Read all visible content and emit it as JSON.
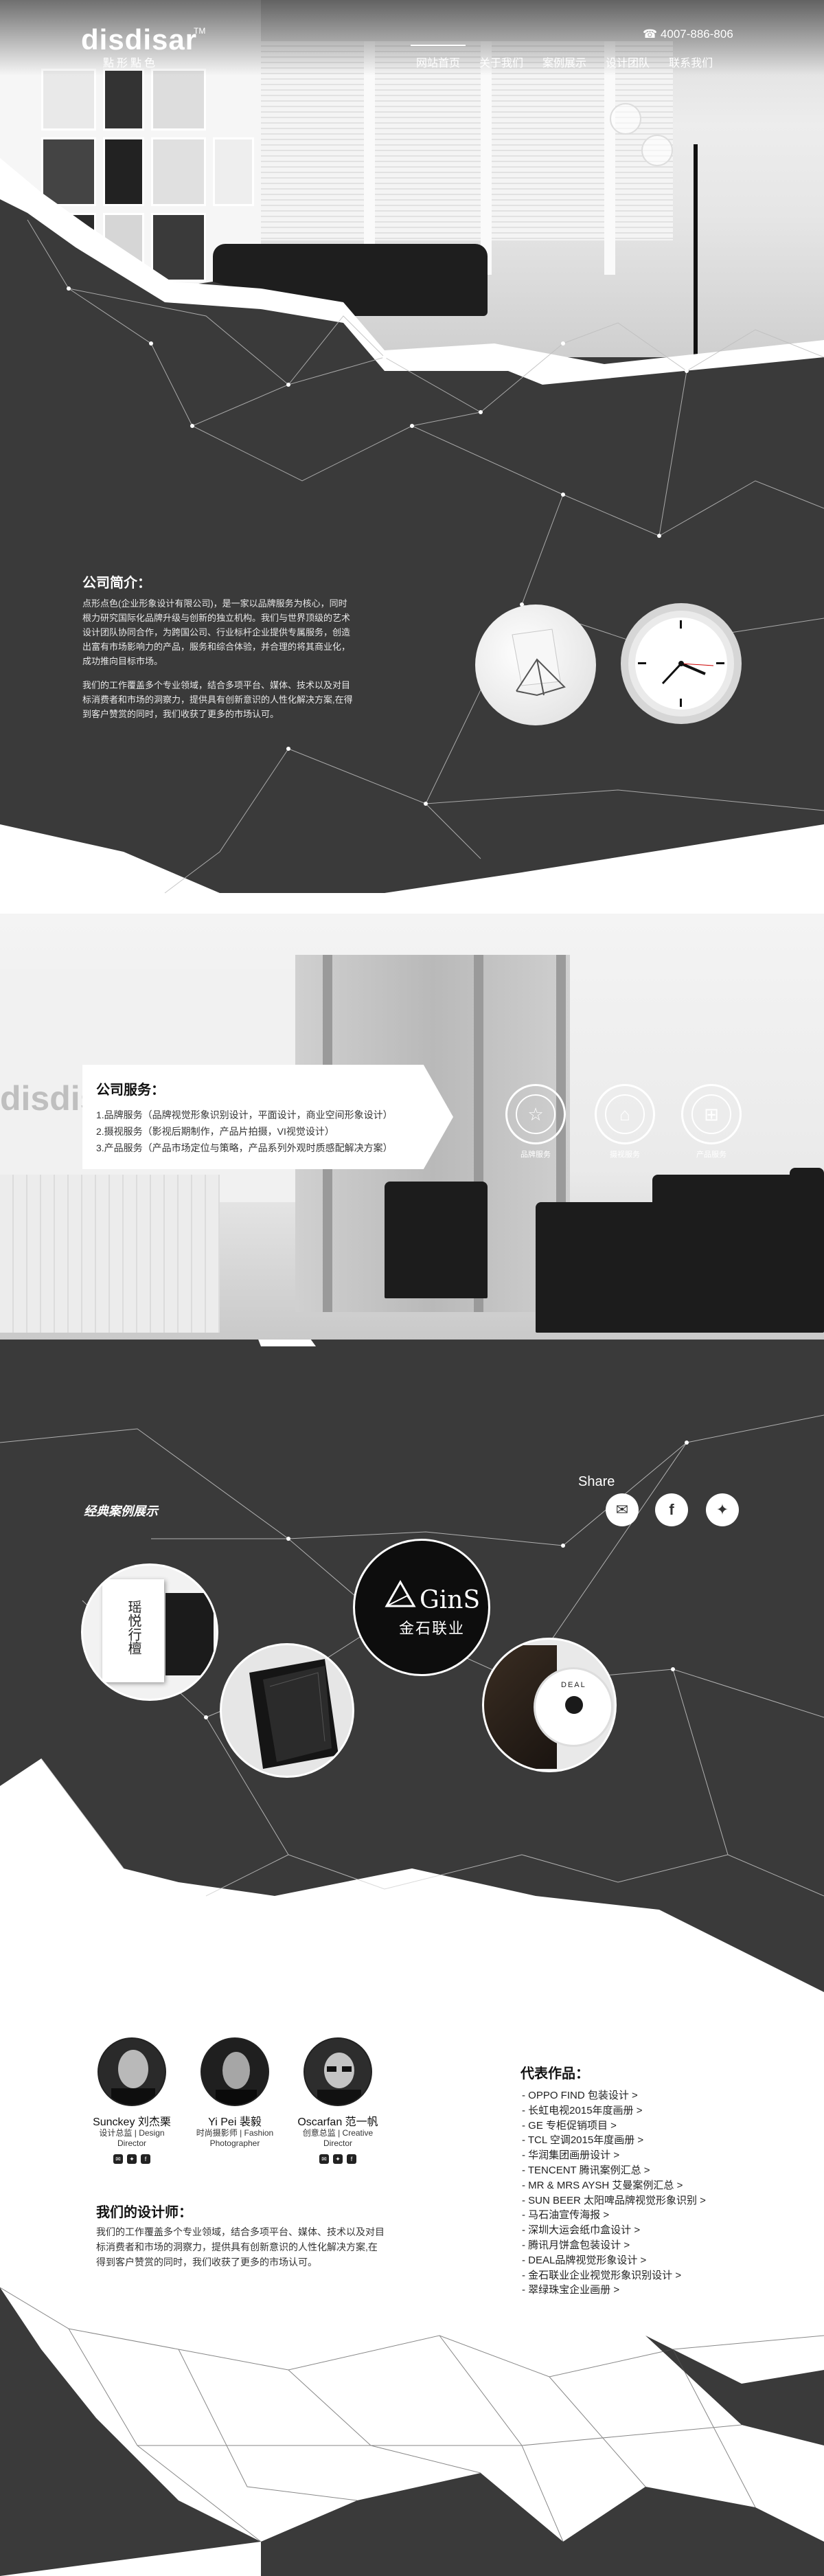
{
  "brand": {
    "logo": "disdisar",
    "tm": "TM",
    "logo_cn": "點形點色"
  },
  "header": {
    "phone": "4007-886-806",
    "nav": [
      {
        "label": "网站首页",
        "active": true
      },
      {
        "label": "关于我们",
        "active": false
      },
      {
        "label": "案例展示",
        "active": false
      },
      {
        "label": "设计团队",
        "active": false
      },
      {
        "label": "联系我们",
        "active": false
      }
    ]
  },
  "about": {
    "title": "公司简介：",
    "para1": [
      "点形点色(企业形象设计有限公司)，是一家以品牌服务为核心，同时",
      "根力研究国际化品牌升级与创新的独立机构。我们与世界顶级的艺术",
      "设计团队协同合作，为跨国公司、行业标杆企业提供专属服务，创造",
      "出富有市场影响力的产品，服务和综合体验，并合理的将其商业化，",
      "成功推向目标市场。"
    ],
    "para2": [
      "我们的工作覆盖多个专业领域，结合多项平台、媒体、技术以及对目",
      "标消费者和市场的洞察力，提供具有创新意识的人性化解决方案,在得",
      "到客户赞赏的同时，我们收获了更多的市场认可。"
    ]
  },
  "services": {
    "title": "公司服务：",
    "lines": [
      "1.品牌服务（品牌视觉形象识别设计，平面设计，商业空间形象设计）",
      "2.摄视服务（影视后期制作，产品片拍摄，VI视觉设计）",
      "3.产品服务（产品市场定位与策略，产品系列外观时质感配解决方案）"
    ],
    "icons": [
      {
        "label": "品牌服务",
        "icon": "star-icon"
      },
      {
        "label": "摄视服务",
        "icon": "camera-icon"
      },
      {
        "label": "产品服务",
        "icon": "grid-icon"
      }
    ]
  },
  "cases": {
    "title": "经典案例展示",
    "share_label": "Share",
    "share_buttons": [
      {
        "icon": "chat-icon",
        "glyph": "✉"
      },
      {
        "icon": "facebook-icon",
        "glyph": "f"
      },
      {
        "icon": "twitter-icon",
        "glyph": "✦"
      }
    ],
    "featured_logo_en": "GinS",
    "featured_logo_cn": "金石联业",
    "book_title": "瑶悦行檀",
    "deal_text": "DEAL"
  },
  "designers": {
    "people": [
      {
        "name": "Sunckey 刘杰栗",
        "role1": "设计总监 | Design",
        "role2": "Director"
      },
      {
        "name": "Yi Pei 裴毅",
        "role1": "时尚摄影师 | Fashion",
        "role2": "Photographer"
      },
      {
        "name": "Oscarfan 范一帆",
        "role1": "创意总监 | Creative",
        "role2": "Director"
      }
    ],
    "icons": [
      "✉",
      "✦",
      "f"
    ],
    "team_title": "我们的设计师：",
    "team_text": [
      "我们的工作覆盖多个专业领域，结合多项平台、媒体、技术以及对目",
      "标消费者和市场的洞察力，提供具有创新意识的人性化解决方案,在",
      "得到客户赞赏的同时，我们收获了更多的市场认可。"
    ]
  },
  "works": {
    "title": "代表作品：",
    "items": [
      "- OPPO FIND 包装设计 >",
      "- 长虹电视2015年度画册 >",
      "- GE 专柜促销项目 >",
      "- TCL 空调2015年度画册 >",
      "- 华润集团画册设计 >",
      "- TENCENT 腾讯案例汇总 >",
      "- MR & MRS AYSH 艾曼案例汇总 >",
      "- SUN BEER 太阳啤品牌视觉形象识别 >",
      "- 马石油宣传海报 >",
      "- 深圳大运会纸巾盒设计 >",
      "- 腾讯月饼盒包装设计 >",
      "- DEAL品牌视觉形象设计 >",
      "- 金石联业企业视觉形象识别设计 >",
      "- 翠绿珠宝企业画册 >"
    ]
  },
  "colors": {
    "dark": "#3a3a3a",
    "white": "#ffffff",
    "text": "#222222"
  }
}
